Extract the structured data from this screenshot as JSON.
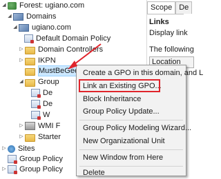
{
  "tree": {
    "forest": "Forest: ugiano.com",
    "domains": "Domains",
    "domain": "ugiano.com",
    "default_policy": "Default Domain Policy",
    "domain_controllers": "Domain Controllers",
    "ikpn": "IKPN",
    "mustbegeek": "MustBeGeek",
    "group_policy_objects": "Group",
    "gpo_children": [
      "De",
      "De",
      "W"
    ],
    "wmi": "WMI F",
    "starter": "Starter",
    "sites": "Sites",
    "gp_modeling": "Group Policy",
    "gp_results": "Group Policy"
  },
  "right_pane": {
    "tab_scope": "Scope",
    "tab_details": "De",
    "links_heading": "Links",
    "display_text": "Display link",
    "following_text": "The following",
    "location_label": "Location"
  },
  "menu": {
    "items": [
      "Create a GPO in this domain, and L",
      "Link an Existing GPO...",
      "Block Inheritance",
      "Group Policy Update...",
      "Group Policy Modeling Wizard...",
      "New Organizational Unit",
      "New Window from Here",
      "Delete"
    ]
  },
  "colors": {
    "selection": "#cce8ff",
    "highlight_border": "#e0242b",
    "menu_bg": "#f2f2f2"
  }
}
